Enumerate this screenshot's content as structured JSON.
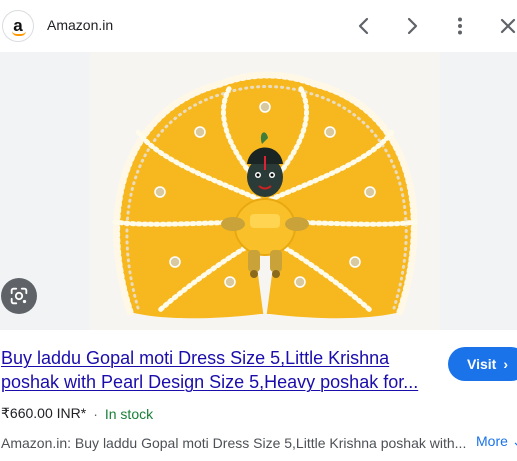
{
  "header": {
    "site_logo_letter": "a",
    "site_name": "Amazon.in",
    "icons": [
      "back-arrow-icon",
      "forward-arrow-icon",
      "more-vert-icon",
      "close-icon"
    ]
  },
  "image": {
    "lens_icon": "google-lens-icon",
    "background_color": "#f1f3f4"
  },
  "result": {
    "title": "Buy laddu Gopal moti Dress Size 5,Little Krishna poshak with Pearl Design Size 5,Heavy poshak for...",
    "visit_label": "Visit",
    "price": "₹660.00 INR*",
    "separator": "·",
    "stock": "In stock",
    "description": "Amazon.in: Buy laddu Gopal moti Dress Size 5,Little Krishna poshak with...",
    "more_label": "More"
  },
  "colors": {
    "link": "#1a0dab",
    "accent": "#1a73e8",
    "in_stock": "#188038",
    "dress_yellow": "#f7b81f"
  }
}
